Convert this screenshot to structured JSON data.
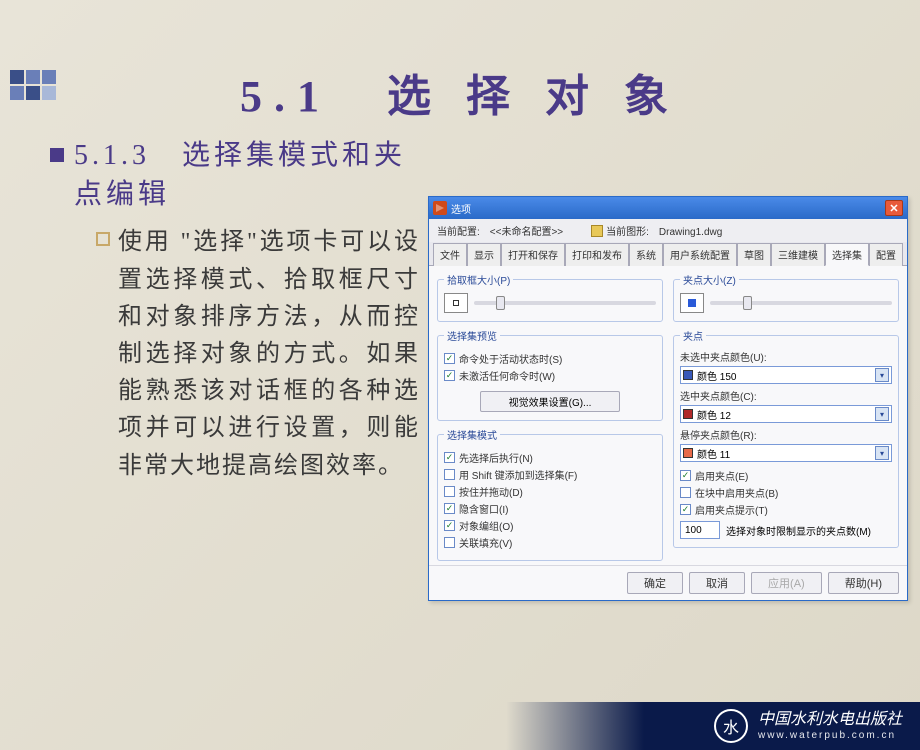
{
  "slide": {
    "title": "5.1　选 择 对 象",
    "subhead_number": "5.1.3",
    "subhead_text": "选择集模式和夹点编辑",
    "paragraph": "使用 \"选择\"选项卡可以设置选择模式、拾取框尺寸和对象排序方法，从而控制选择对象的方式。如果能熟悉该对话框的各种选项并可以进行设置，则能非常大地提高绘图效率。"
  },
  "dialog": {
    "title": "选项",
    "current_config_label": "当前配置:",
    "current_config_value": "<<未命名配置>>",
    "current_drawing_label": "当前图形:",
    "current_drawing_value": "Drawing1.dwg",
    "tabs": [
      "文件",
      "显示",
      "打开和保存",
      "打印和发布",
      "系统",
      "用户系统配置",
      "草图",
      "三维建模",
      "选择集",
      "配置"
    ],
    "active_tab_index": 8,
    "left": {
      "pickbox_legend": "拾取框大小(P)",
      "preview_legend": "选择集预览",
      "preview_chk1": "命令处于活动状态时(S)",
      "preview_chk2": "未激活任何命令时(W)",
      "preview_btn": "视觉效果设置(G)...",
      "mode_legend": "选择集模式",
      "mode_items": [
        {
          "label": "先选择后执行(N)",
          "checked": true
        },
        {
          "label": "用 Shift 键添加到选择集(F)",
          "checked": false
        },
        {
          "label": "按住并拖动(D)",
          "checked": false
        },
        {
          "label": "隐含窗口(I)",
          "checked": true
        },
        {
          "label": "对象编组(O)",
          "checked": true
        },
        {
          "label": "关联填充(V)",
          "checked": false
        }
      ]
    },
    "right": {
      "gripsize_legend": "夹点大小(Z)",
      "grips_legend": "夹点",
      "unsel_label": "未选中夹点颜色(U):",
      "unsel_color": "颜色 150",
      "unsel_swatch": "#3858b8",
      "sel_label": "选中夹点颜色(C):",
      "sel_color": "颜色 12",
      "sel_swatch": "#b02828",
      "hover_label": "悬停夹点颜色(R):",
      "hover_color": "颜色 11",
      "hover_swatch": "#e86a48",
      "enable_grips": "启用夹点(E)",
      "enable_grips_block": "在块中启用夹点(B)",
      "enable_grip_tips": "启用夹点提示(T)",
      "limit_value": "100",
      "limit_label": "选择对象时限制显示的夹点数(M)"
    },
    "buttons": {
      "ok": "确定",
      "cancel": "取消",
      "apply": "应用(A)",
      "help": "帮助(H)"
    }
  },
  "footer": {
    "publisher": "中国水利水电出版社",
    "url": "www.waterpub.com.cn"
  }
}
